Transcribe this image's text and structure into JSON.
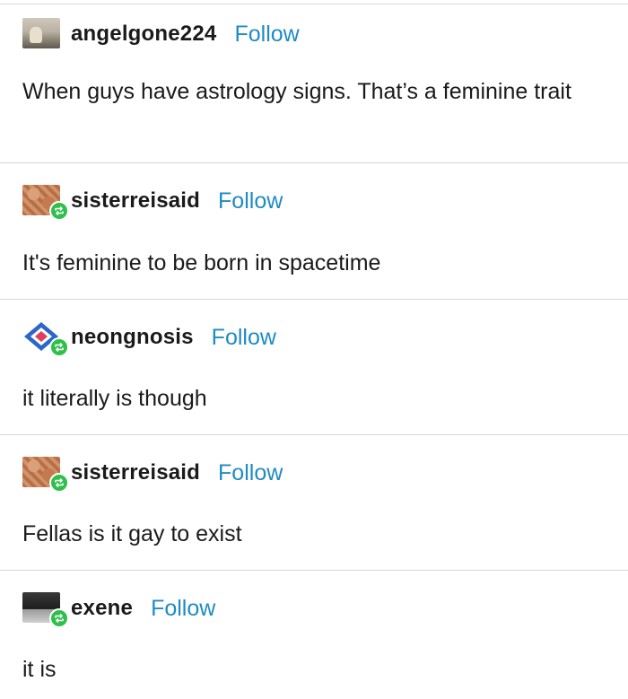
{
  "posts": [
    {
      "username": "angelgone224",
      "follow_label": "Follow",
      "avatar": "avatar-photo",
      "reblog": false,
      "text": "When guys have astrology signs. That’s a feminine trait"
    },
    {
      "username": "sisterreisaid",
      "follow_label": "Follow",
      "avatar": "avatar-pattern",
      "reblog": true,
      "text": "It's feminine to be born in spacetime"
    },
    {
      "username": "neongnosis",
      "follow_label": "Follow",
      "avatar": "avatar-geometric",
      "reblog": true,
      "text": "it literally is though"
    },
    {
      "username": "sisterreisaid",
      "follow_label": "Follow",
      "avatar": "avatar-pattern",
      "reblog": true,
      "text": "Fellas is it gay to exist"
    },
    {
      "username": "exene",
      "follow_label": "Follow",
      "avatar": "avatar-photo",
      "reblog": true,
      "text": "it is"
    }
  ],
  "colors": {
    "follow": "#1e8bc3",
    "reblog_badge": "#2ec04b",
    "divider": "#d6d6d6",
    "text": "#1a1a1a"
  },
  "icons": {
    "reblog": "reblog-icon"
  }
}
